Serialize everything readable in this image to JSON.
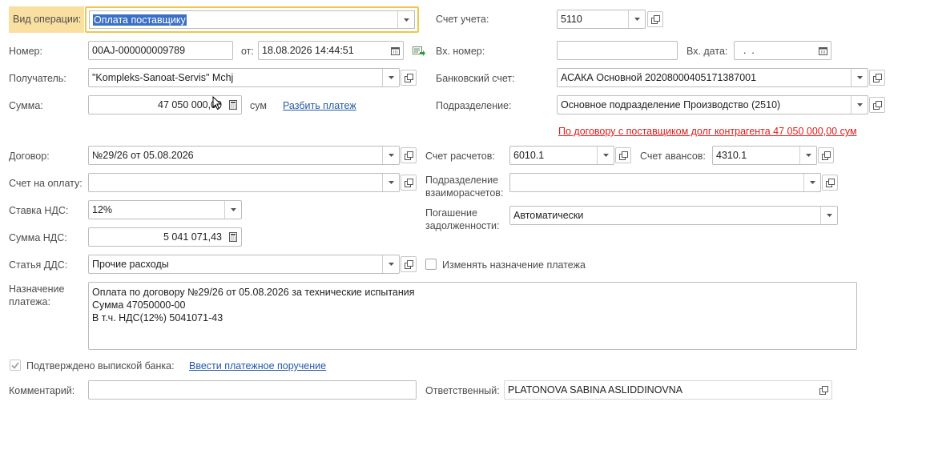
{
  "operation": {
    "label": "Вид операции:",
    "value": "Оплата поставщику"
  },
  "account": {
    "label": "Счет учета:",
    "value": "5110"
  },
  "number": {
    "label": "Номер:",
    "value": "00AJ-000000009789"
  },
  "date": {
    "label": "от:",
    "value": "18.08.2026 14:44:51"
  },
  "incoming_number": {
    "label": "Вх. номер:",
    "value": ""
  },
  "incoming_date": {
    "label": "Вх. дата:",
    "value": "  .  .    "
  },
  "recipient": {
    "label": "Получатель:",
    "value": "\"Kompleks-Sanoat-Servis\" Mchj"
  },
  "bank_account": {
    "label": "Банковский счет:",
    "value": "АСАКА Основной 20208000405171387001"
  },
  "amount": {
    "label": "Сумма:",
    "value": "47 050 000,00",
    "currency": "сум",
    "split_link": "Разбить платеж"
  },
  "division": {
    "label": "Подразделение:",
    "value": "Основное подразделение Производство (2510)"
  },
  "debt_warning": "По договору с поставщиком долг контрагента 47 050 000,00 сум",
  "contract": {
    "label": "Договор:",
    "value": "№29/26 от 05.08.2026"
  },
  "settlement_account": {
    "label": "Счет расчетов:",
    "value": "6010.1"
  },
  "advance_account": {
    "label": "Счет авансов:",
    "value": "4310.1"
  },
  "invoice": {
    "label": "Счет на оплату:",
    "value": ""
  },
  "settlement_division": {
    "label": "Подразделение взаиморасчетов:",
    "value": ""
  },
  "vat_rate": {
    "label": "Ставка НДС:",
    "value": "12%"
  },
  "debt_repayment": {
    "label": "Погашение задолженности:",
    "value": "Автоматически"
  },
  "vat_amount": {
    "label": "Сумма НДС:",
    "value": "5 041 071,43"
  },
  "cash_flow_item": {
    "label": "Статья ДДС:",
    "value": "Прочие расходы"
  },
  "change_purpose": {
    "label": "Изменять назначение платежа",
    "checked": false
  },
  "purpose": {
    "label": "Назначение платежа:",
    "lines": [
      "Оплата по договору №29/26 от 05.08.2026 за технические испытания",
      "Сумма 47050000-00",
      "В т.ч. НДС(12%) 5041071-43"
    ]
  },
  "bank_confirmed": {
    "label": "Подтверждено выпиской банка:",
    "checked": true,
    "link": "Ввести платежное поручение"
  },
  "comment": {
    "label": "Комментарий:",
    "value": ""
  },
  "responsible": {
    "label": "Ответственный:",
    "value": "PLATONOVA SABINA ASLIDDINOVNA"
  },
  "colors": {
    "highlight": "#f9dfa0",
    "focus_border": "#f3c54b",
    "link": "#2659a8",
    "warning": "#e01b1b",
    "selection": "#3a6fc6"
  }
}
